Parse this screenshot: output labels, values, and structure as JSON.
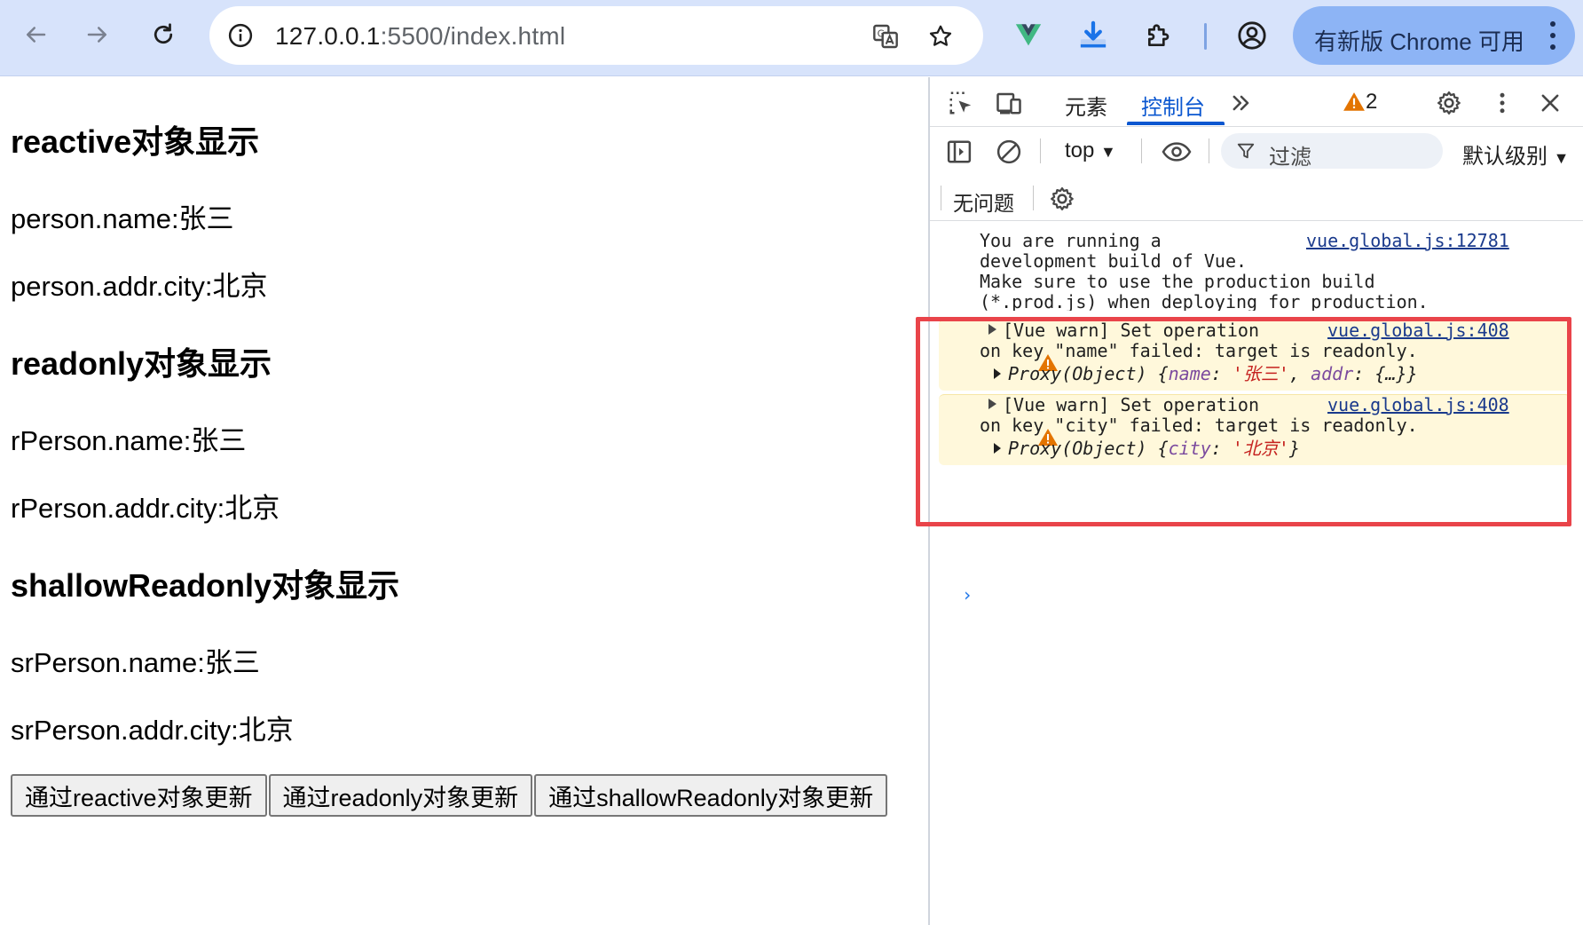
{
  "browser": {
    "url_host": "127.0.0.1",
    "url_rest": ":5500/index.html",
    "update_label": "有新版 Chrome 可用",
    "accent": "#0b57d0"
  },
  "page": {
    "sections": [
      {
        "title": "reactive对象显示",
        "name_line": "person.name:张三",
        "city_line": "person.addr.city:北京"
      },
      {
        "title": "readonly对象显示",
        "name_line": "rPerson.name:张三",
        "city_line": "rPerson.addr.city:北京"
      },
      {
        "title": "shallowReadonly对象显示",
        "name_line": "srPerson.name:张三",
        "city_line": "srPerson.addr.city:北京"
      }
    ],
    "buttons": [
      "通过reactive对象更新",
      "通过readonly对象更新",
      "通过shallowReadonly对象更新"
    ]
  },
  "devtools": {
    "tabs": {
      "elements": "元素",
      "console": "控制台"
    },
    "warning_count": "2",
    "context": "top",
    "filter_placeholder": "过滤",
    "level": "默认级别",
    "issues": "无问题",
    "messages": {
      "info": {
        "lines": "You are running a\ndevelopment build of Vue.\nMake sure to use the production build\n(*.prod.js) when deploying for production.",
        "source": "vue.global.js:12781"
      },
      "warn1": {
        "line1": "[Vue warn] Set operation",
        "line2": "on key \"name\" failed: target is readonly.",
        "proxy_prefix": "Proxy(Object) {",
        "key1": "name",
        "val1": "'张三'",
        "key2": "addr",
        "val2": "{…}}",
        "source": "vue.global.js:408"
      },
      "warn2": {
        "line1": "[Vue warn] Set operation",
        "line2": "on key \"city\" failed: target is readonly.",
        "proxy_prefix": "Proxy(Object) {",
        "key1": "city",
        "val1": "'北京'",
        "suffix": "}",
        "source": "vue.global.js:408"
      }
    }
  }
}
